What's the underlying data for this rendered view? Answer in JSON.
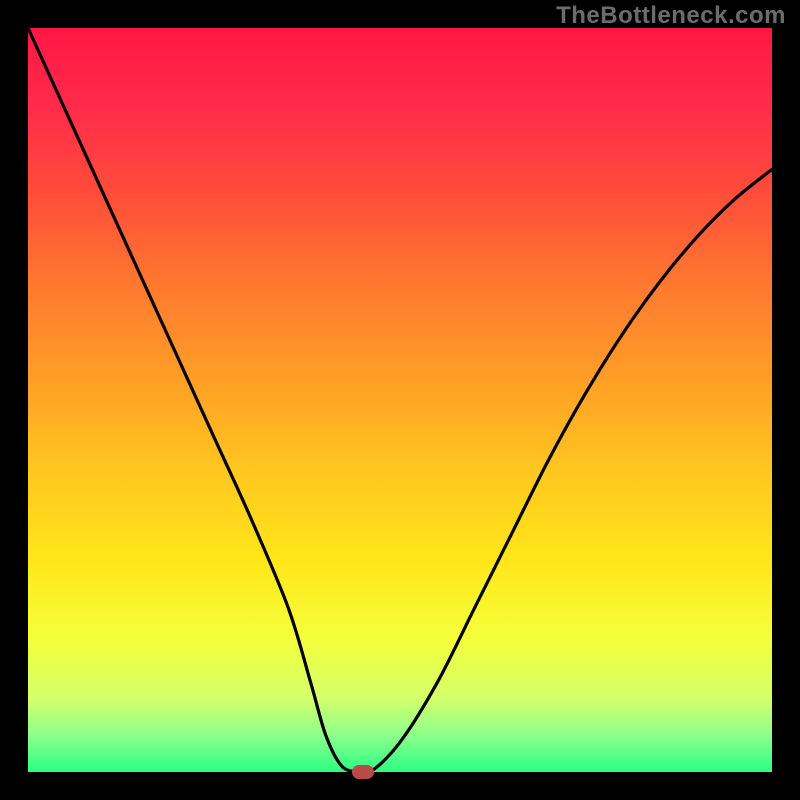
{
  "watermark": "TheBottleneck.com",
  "chart_data": {
    "type": "line",
    "title": "",
    "xlabel": "",
    "ylabel": "",
    "xlim": [
      0,
      100
    ],
    "ylim": [
      0,
      100
    ],
    "x": [
      0,
      5,
      10,
      15,
      20,
      25,
      30,
      35,
      38,
      40,
      42,
      44,
      46,
      50,
      55,
      60,
      65,
      70,
      75,
      80,
      85,
      90,
      95,
      100
    ],
    "y": [
      100,
      89,
      78,
      67,
      56,
      45,
      34,
      22,
      12,
      5,
      1,
      0,
      0,
      4,
      12,
      22,
      32,
      42,
      51,
      59,
      66,
      72,
      77,
      81
    ],
    "marker": {
      "x": 45,
      "y": 0
    },
    "note": "Values are read off the plot as percentages of the axis span. The curve is a V-shaped bottleneck profile reaching a minimum of 0 near x≈44–46 where the red marker sits."
  },
  "colors": {
    "gradient_top": "#ff1744",
    "gradient_mid": "#ffe71a",
    "gradient_bottom": "#2aff83",
    "curve": "#000000",
    "marker": "#b94a4a",
    "frame": "#000000"
  }
}
